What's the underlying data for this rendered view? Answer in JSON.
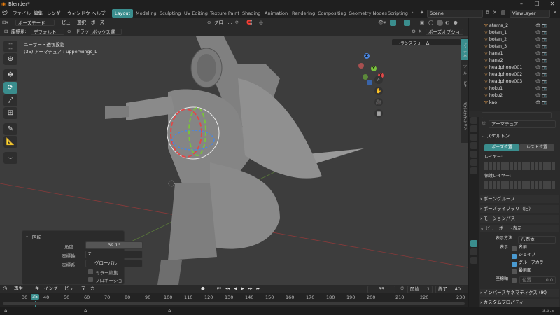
{
  "window": {
    "title": "Blender*"
  },
  "menus": [
    "ファイル",
    "編集",
    "レンダー",
    "ウィンドウ",
    "ヘルプ"
  ],
  "workspaces": [
    "Layout",
    "Modeling",
    "Sculpting",
    "UV Editing",
    "Texture Paint",
    "Shading",
    "Animation",
    "Rendering",
    "Compositing",
    "Geometry Nodes",
    "Scripting"
  ],
  "active_workspace": "Layout",
  "scene": "Scene",
  "view_layer": "ViewLayer",
  "header3d": {
    "mode": "ポーズモード",
    "menus": [
      "ビュー",
      "選択",
      "ポーズ"
    ],
    "orientation_label": "座標系:",
    "orientation_value": "デフォルト",
    "drag_label": "ドラッグ:",
    "drag_value": "ボックス選択",
    "transform_orientation": "グロー...",
    "pose_options": "ポーズオプション"
  },
  "viewport": {
    "view_name": "ユーザー・透視投影",
    "object_info": "(35) アーマチュア : upperwings_L",
    "transform_panel": "トランスフォーム",
    "side_tabs": [
      "アイテム",
      "ツール",
      "ビュー",
      "パネルオプション"
    ],
    "gizmo_axes": {
      "x": "X",
      "y": "Y",
      "z": "Z"
    }
  },
  "operator_panel": {
    "title": "回転",
    "angle_label": "角度",
    "angle_value": "39.1°",
    "axis_label": "座標軸",
    "axis_value": "Z",
    "orient_label": "座標系",
    "orient_value": "グローバル",
    "mirror_label": "ミラー編集",
    "proportional_label": "プロポーショナル編集"
  },
  "timeline": {
    "playback": "再生",
    "keying": "キーイング",
    "view": "ビュー",
    "marker": "マーカー",
    "current_frame": "35",
    "start_label": "開始",
    "start": "1",
    "end_label": "終了",
    "end": "40",
    "ruler_ticks": [
      "30",
      "35",
      "40",
      "50",
      "60",
      "70",
      "80",
      "90",
      "100",
      "110",
      "120",
      "130",
      "140",
      "150",
      "160",
      "170",
      "180",
      "190",
      "200",
      "210",
      "220",
      "230"
    ]
  },
  "outliner": {
    "items": [
      "atama_2",
      "botan_1",
      "botan_2",
      "botan_3",
      "hane1",
      "hane2",
      "headphone001",
      "headphone002",
      "headphone003",
      "hoku1",
      "hoku2",
      "kao"
    ]
  },
  "properties": {
    "object_name": "アーマチュア",
    "section_skeleton": "スケルトン",
    "pose_position": "ポーズ位置",
    "rest_position": "レスト位置",
    "layers_label": "レイヤー:",
    "protected_layers_label": "保護レイヤー:",
    "bone_groups": "ボーングループ",
    "pose_library": "ポーズライブラリ（旧）",
    "motion_paths": "モーションパス",
    "viewport_display": "ビューポート表示",
    "display_as_label": "表示方法",
    "display_as_value": "八面体",
    "show_label": "表示",
    "names_label": "名前",
    "shapes_label": "シェイプ",
    "group_colors_label": "グループカラー",
    "in_front_label": "最前面",
    "axes_label": "座標軸",
    "position_label": "位置",
    "position_value": "0.0",
    "ik": "インバースキネマティクス (IK)",
    "custom_props": "カスタムプロパティ"
  },
  "status": {
    "version": "3.3.5"
  },
  "colors": {
    "accent": "#3a8d8d",
    "x_axis": "#e04848",
    "y_axis": "#7ac23c",
    "z_axis": "#4a86e0"
  }
}
